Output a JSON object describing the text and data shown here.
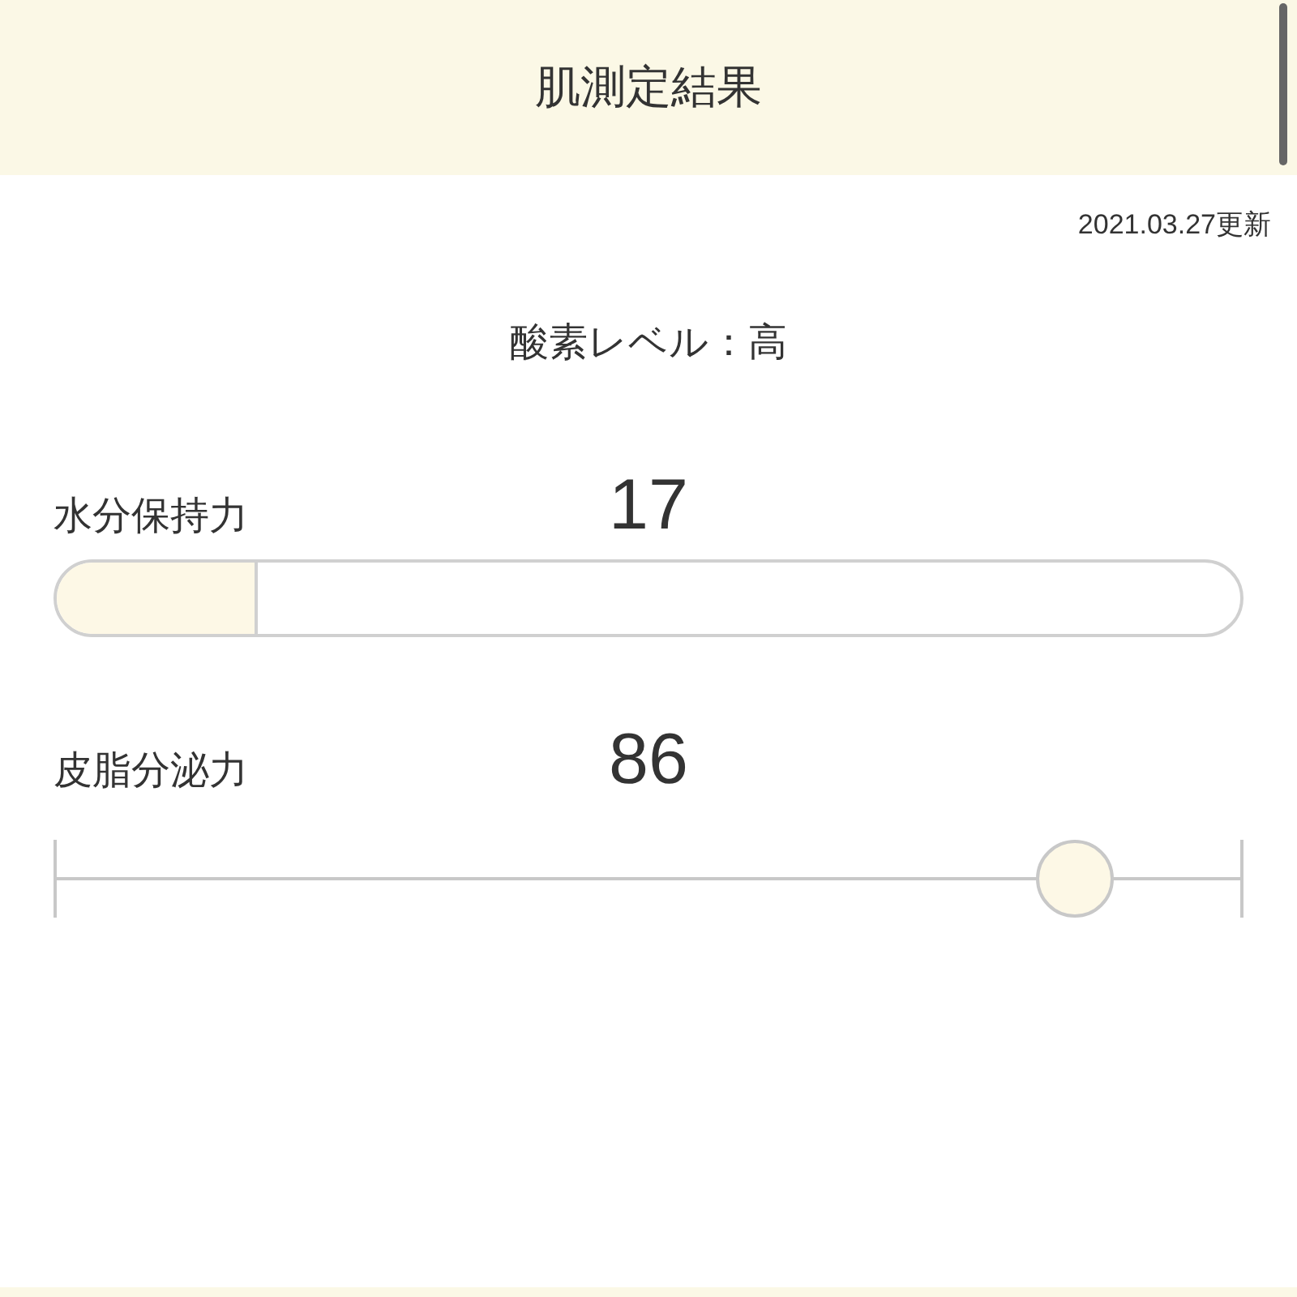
{
  "header": {
    "title": "肌測定結果"
  },
  "updated": "2021.03.27更新",
  "oxygen": "酸素レベル：高",
  "metrics": [
    {
      "kind": "bar",
      "label": "水分保持力",
      "value": "17",
      "level": 0.17
    },
    {
      "kind": "slider",
      "label": "皮脂分泌力",
      "value": "86",
      "level": 0.86
    }
  ]
}
